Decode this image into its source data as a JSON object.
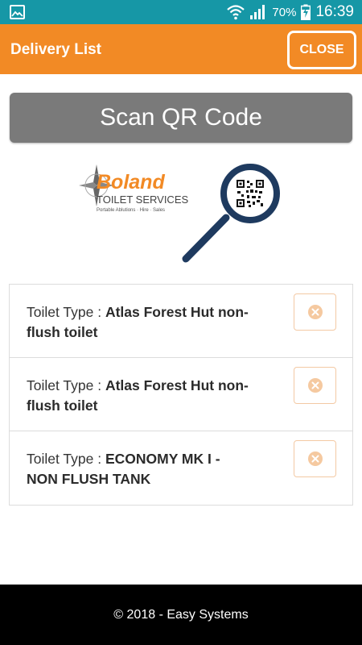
{
  "status": {
    "battery": "70%",
    "time": "16:39"
  },
  "header": {
    "title": "Delivery List",
    "close_label": "CLOSE"
  },
  "scan": {
    "label": "Scan QR Code"
  },
  "logo": {
    "brand": "Boland",
    "subtitle": "TOILET SERVICES",
    "tagline": "Portable Ablutions · Hire · Sales"
  },
  "items": [
    {
      "label": "Toilet Type : ",
      "value_line1": "Atlas Forest Hut non-",
      "value_line2": "flush toilet"
    },
    {
      "label": "Toilet Type : ",
      "value_line1": "Atlas Forest Hut non-",
      "value_line2": "flush toilet"
    },
    {
      "label": "Toilet Type : ",
      "value_line1": "ECONOMY MK I -",
      "value_line2": "NON FLUSH TANK"
    }
  ],
  "footer": {
    "text": "© 2018 - Easy Systems"
  },
  "colors": {
    "status_bar": "#1697a6",
    "app_bar": "#f28a25",
    "scan_button": "#7a7a7a",
    "delete_icon": "#f5c9a0",
    "magnifier": "#1e3a5f"
  }
}
